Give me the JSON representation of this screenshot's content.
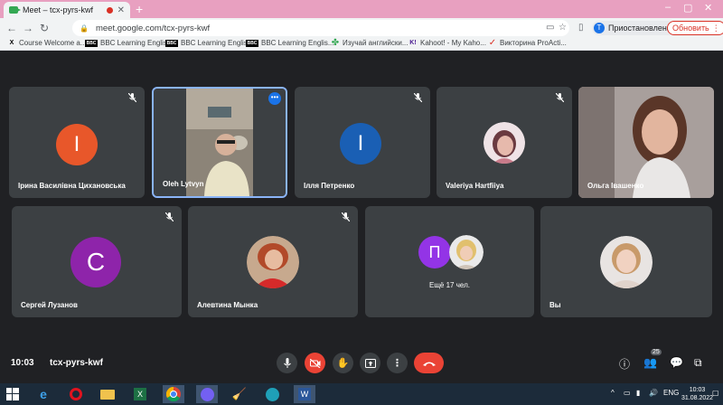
{
  "browser": {
    "tab_title": "Meet – tcx-pyrs-kwf",
    "url": "meet.google.com/tcx-pyrs-kwf",
    "profile_label": "Приостановлена",
    "profile_initial": "T",
    "update_label": "Обновить",
    "bookmarks": [
      {
        "label": "Course Welcome a...",
        "icon": "X"
      },
      {
        "label": "BBC Learning Englis...",
        "icon": "BBC"
      },
      {
        "label": "BBC Learning Englis...",
        "icon": "BBC"
      },
      {
        "label": "BBC Learning Englis...",
        "icon": "BBC"
      },
      {
        "label": "Изучай английски...",
        "icon": "cross"
      },
      {
        "label": "Kahoot! - My Kaho...",
        "icon": "K!"
      },
      {
        "label": "Викторина ProActi...",
        "icon": "check"
      }
    ]
  },
  "meet": {
    "participants": [
      {
        "name": "Ірина Василівна Цихановська",
        "initial": "І",
        "color": "#e8572a",
        "muted": true
      },
      {
        "name": "Oleh Lytvyn",
        "video": true,
        "active": true
      },
      {
        "name": "Ілля Петренко",
        "initial": "І",
        "color": "#1a5fb4",
        "muted": true
      },
      {
        "name": "Valeriya Hartfiiya",
        "photo": true,
        "muted": true
      },
      {
        "name": "Ольга Івашенко",
        "video": true
      },
      {
        "name": "Сергей Лузанов",
        "initial": "С",
        "color": "#8e24aa",
        "muted": true
      },
      {
        "name": "Алевтина Мынка",
        "photo": true,
        "muted": true
      },
      {
        "name": "",
        "group": true,
        "group_initial": "П",
        "group_color": "#9334e6",
        "more_label": "Ещё 17 чел."
      },
      {
        "name": "Вы",
        "photo": true
      }
    ],
    "time": "10:03",
    "meeting_code": "tcx-pyrs-kwf",
    "participant_count": "25"
  },
  "taskbar": {
    "lang": "ENG",
    "time": "10:03",
    "date": "31.08.2022"
  }
}
